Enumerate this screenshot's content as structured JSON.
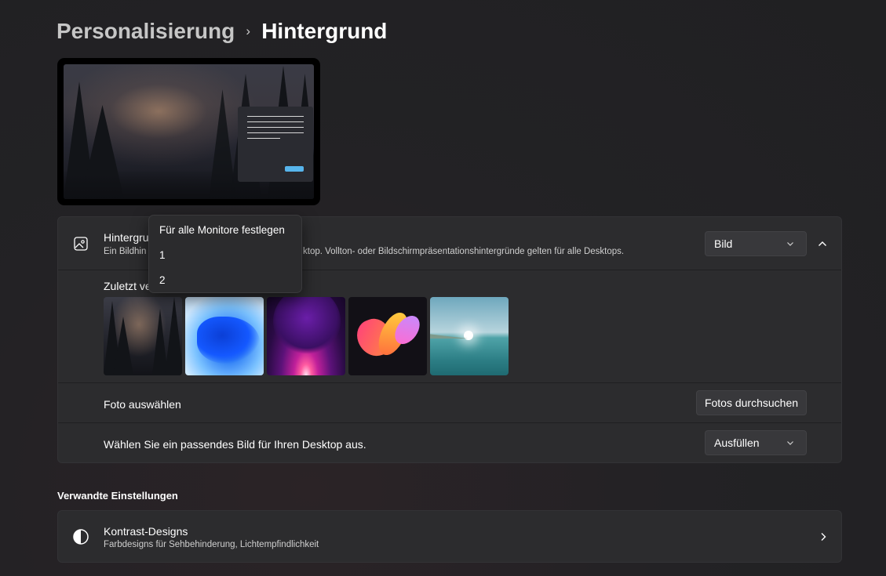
{
  "breadcrumb": {
    "parent": "Personalisierung",
    "separator": "›",
    "current": "Hintergrund"
  },
  "background_setting": {
    "title": "Hintergrund",
    "title_visible": "Hintergru",
    "description": "Ein Bildhintergrund gilt für Ihren aktuellen Desktop. Vollton- oder Bildschirmpräsentationshintergründe gelten für alle Desktops.",
    "description_left_visible": "Ein Bildhin",
    "description_right_visible": "ktop. Vollton- oder Bildschirmpräsentationshintergründe gelten für alle Desktops.",
    "type_dropdown_value": "Bild",
    "icon": "image-icon",
    "expanded": true
  },
  "recent_images": {
    "label": "Zuletzt verwendete Bilder",
    "label_visible": "Zuletzt ve",
    "thumbnails": [
      "forest-mist",
      "windows-bloom-blue",
      "purple-glow",
      "colorful-ribbon",
      "lake-sunrise"
    ]
  },
  "choose_photo": {
    "label": "Foto auswählen",
    "button": "Fotos durchsuchen"
  },
  "fit": {
    "label": "Wählen Sie ein passendes Bild für Ihren Desktop aus.",
    "dropdown_value": "Ausfüllen"
  },
  "related": {
    "heading": "Verwandte Einstellungen",
    "items": [
      {
        "title": "Kontrast-Designs",
        "subtitle": "Farbdesigns für Sehbehinderung, Lichtempfindlichkeit",
        "icon": "contrast-icon"
      }
    ]
  },
  "context_menu": {
    "items": [
      "Für alle Monitore festlegen",
      "1",
      "2"
    ]
  },
  "colors": {
    "accent": "#57b5ec",
    "card": "#2c2c2e",
    "background": "#202022"
  }
}
